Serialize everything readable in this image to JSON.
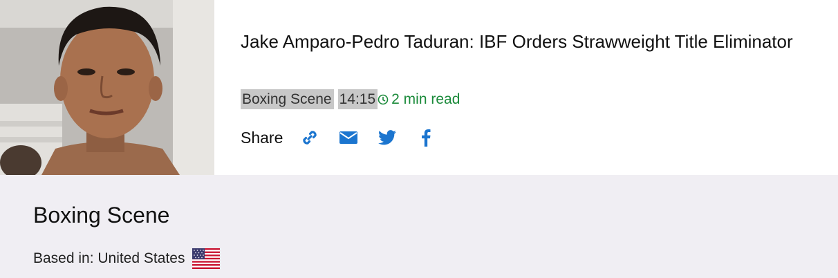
{
  "article": {
    "title": "Jake Amparo-Pedro Taduran: IBF Orders Strawweight Title Eliminator",
    "source_tag": "Boxing Scene",
    "time": "14:15",
    "read_time": "2 min read"
  },
  "share": {
    "label": "Share",
    "icons": [
      "link-icon",
      "envelope-icon",
      "twitter-icon",
      "facebook-icon"
    ]
  },
  "source": {
    "name": "Boxing Scene",
    "based_in": "Based in: United States",
    "flag": "us-flag-icon"
  },
  "colors": {
    "accent_blue": "#1b75cf",
    "read_green": "#1a8a3a",
    "tag_bg": "#c8c8c8",
    "footer_bg": "#f0eef3"
  }
}
